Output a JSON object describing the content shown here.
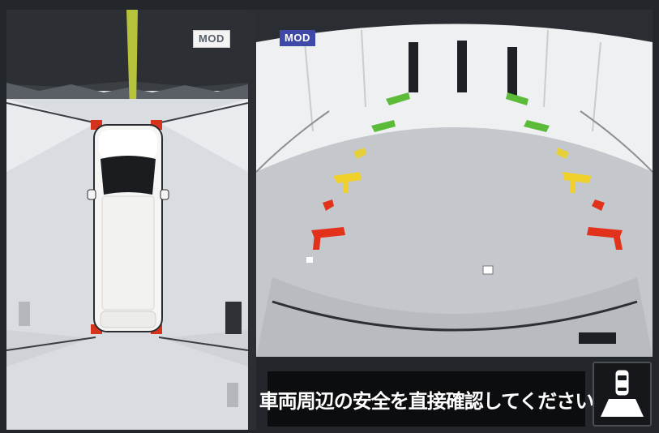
{
  "screen": {
    "left_view": {
      "badge": "MOD"
    },
    "right_view": {
      "badge": "MOD"
    },
    "warning_message": "車両周辺の安全を直接確認してください",
    "view_toggle_button": {
      "icon": "camera-view-icon"
    },
    "colors": {
      "guide_green": "#5dbb3a",
      "guide_yellow": "#f0d02a",
      "guide_red": "#e2321c",
      "mod_badge_active": "#3f4aa8",
      "warning_bg": "#0c0d0f"
    }
  }
}
